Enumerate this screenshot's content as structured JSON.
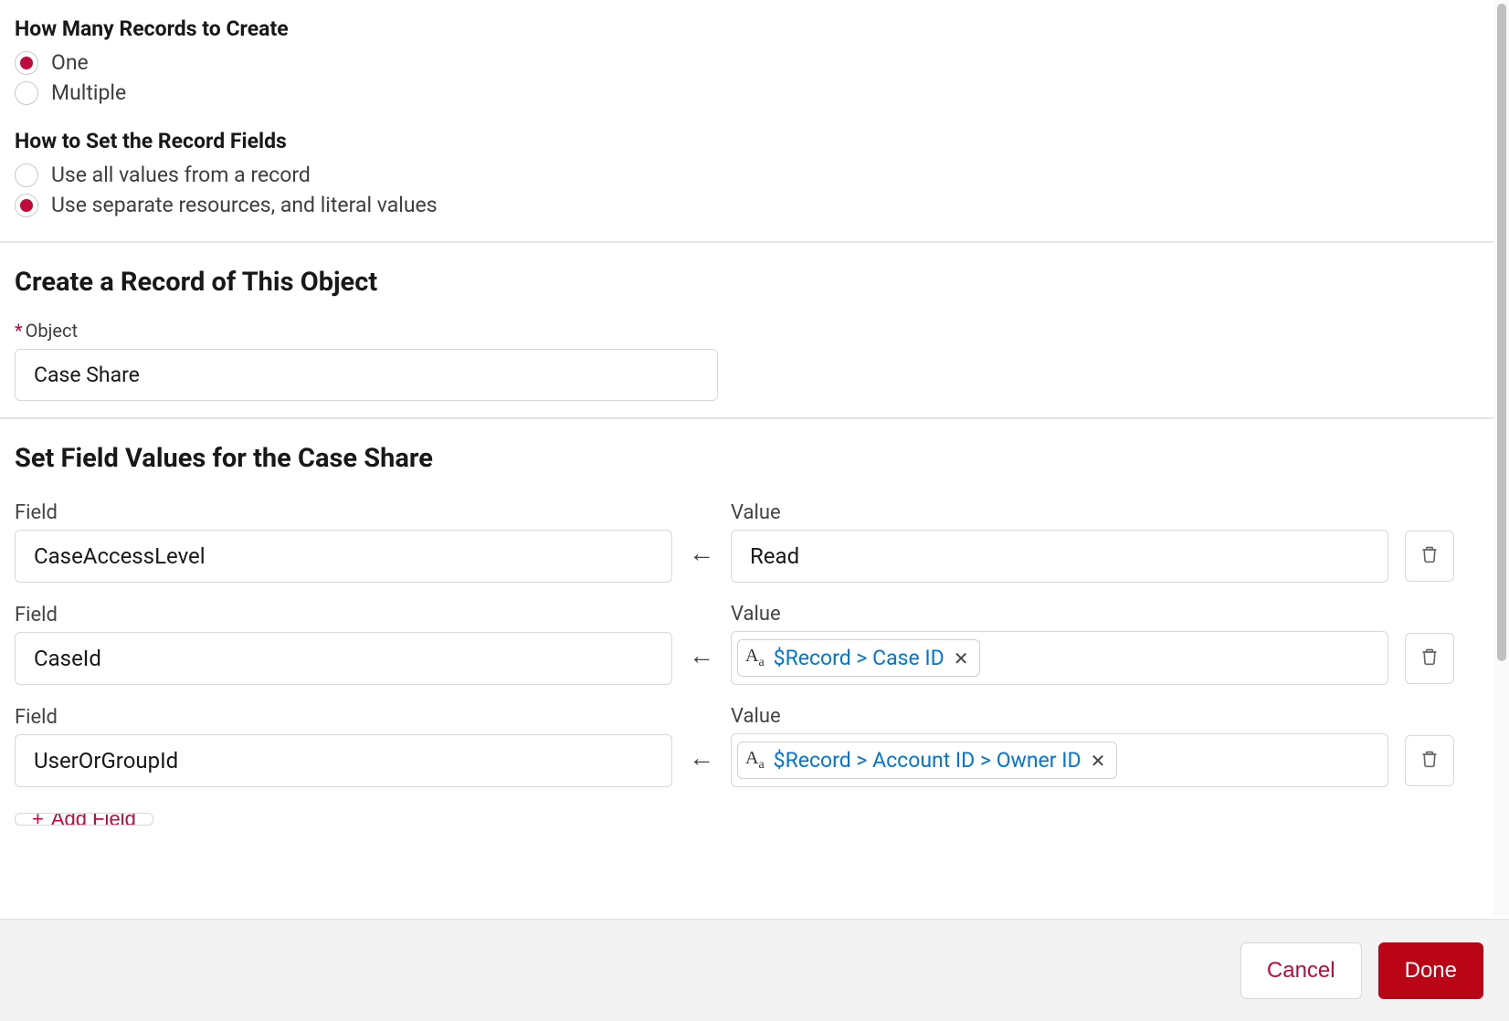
{
  "sections": {
    "howMany": {
      "header": "How Many Records to Create",
      "options": [
        {
          "label": "One",
          "selected": true
        },
        {
          "label": "Multiple",
          "selected": false
        }
      ]
    },
    "howToSet": {
      "header": "How to Set the Record Fields",
      "options": [
        {
          "label": "Use all values from a record",
          "selected": false
        },
        {
          "label": "Use separate resources, and literal values",
          "selected": true
        }
      ]
    },
    "createRecord": {
      "title": "Create a Record of This Object",
      "objectLabel": "Object",
      "objectValue": "Case Share"
    },
    "setFields": {
      "title": "Set Field Values for the Case Share",
      "fieldLabel": "Field",
      "valueLabel": "Value",
      "rows": [
        {
          "field": "CaseAccessLevel",
          "valueType": "text",
          "value": "Read"
        },
        {
          "field": "CaseId",
          "valueType": "pill",
          "value": "$Record > Case ID"
        },
        {
          "field": "UserOrGroupId",
          "valueType": "pill",
          "value": "$Record > Account ID > Owner ID"
        }
      ],
      "addFieldLabel": "Add Field"
    }
  },
  "footer": {
    "cancel": "Cancel",
    "done": "Done"
  }
}
